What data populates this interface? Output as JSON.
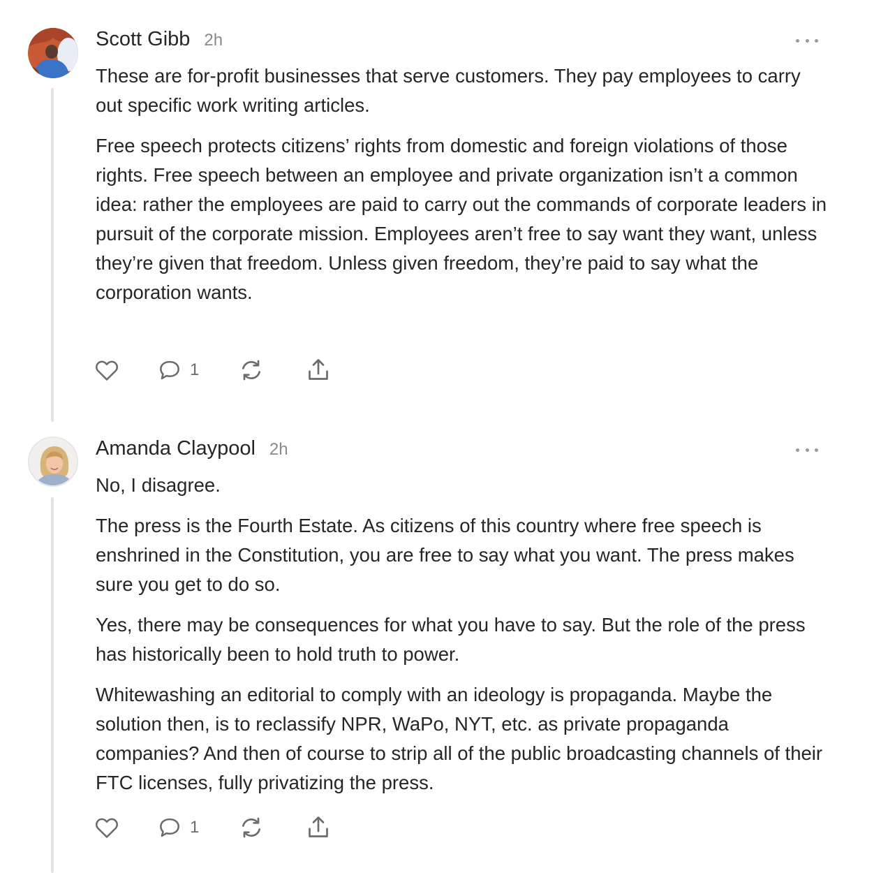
{
  "comments": [
    {
      "author": "Scott Gibb",
      "time": "2h",
      "paragraphs": [
        "These are for-profit businesses that serve customers. They pay employees to carry out specific work writing articles.",
        "Free speech protects citizens’ rights from domestic and foreign violations of those rights. Free speech between an employee and private organization isn’t a common idea: rather the employees are paid to carry out the commands of corporate leaders in pursuit of the corporate mission. Employees aren’t free to say want they want, unless they’re given that freedom. Unless given freedom, they’re paid to say what the corporation wants."
      ],
      "reply_count": "1"
    },
    {
      "author": "Amanda Claypool",
      "time": "2h",
      "paragraphs": [
        "No, I disagree.",
        "The press is the Fourth Estate. As citizens of this country where free speech is enshrined in the Constitution, you are free to say what you want. The press makes sure you get to do so.",
        "Yes, there may be consequences for what you have to say. But the role of the press has historically been to hold truth to power.",
        "Whitewashing an editorial to comply with an ideology is propaganda. Maybe the solution then, is to reclassify NPR, WaPo, NYT, etc. as private propaganda companies? And then of course to strip all of the public broadcasting channels of their FTC licenses, fully privatizing the press."
      ],
      "reply_count": "1"
    }
  ],
  "icons": {
    "like": "heart-icon",
    "reply": "comment-bubble-icon",
    "restack": "restack-icon",
    "share": "share-icon",
    "more": "more-dots-icon"
  },
  "colors": {
    "text": "#262626",
    "muted": "#8a8a8a",
    "icon": "#6b6b6b",
    "thread_line": "#e4e4e4"
  }
}
